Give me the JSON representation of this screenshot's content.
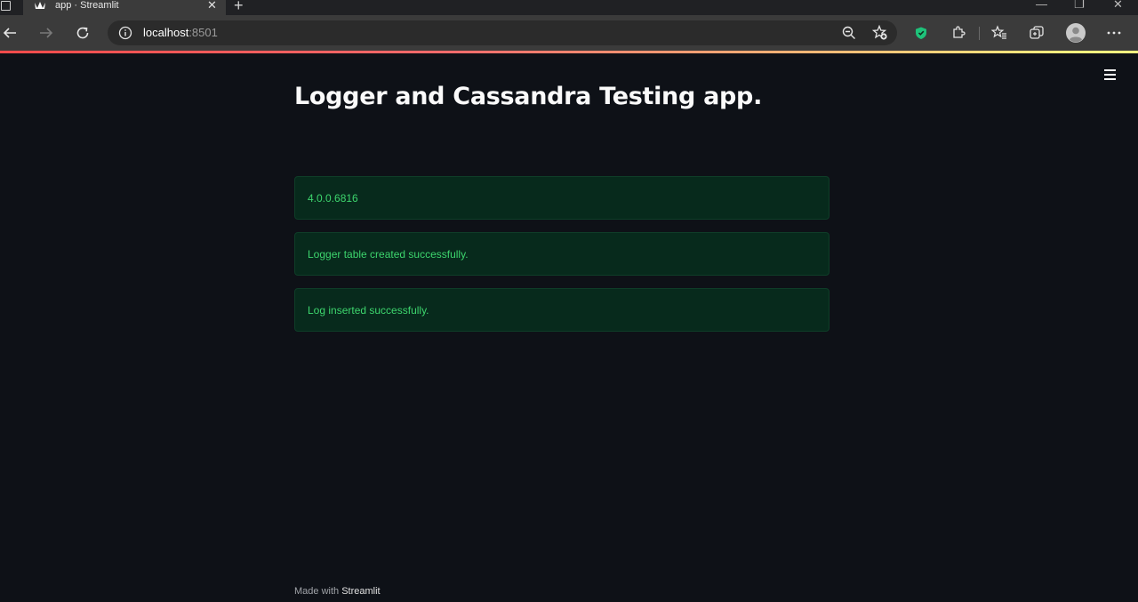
{
  "browser": {
    "tab_title": "app · Streamlit",
    "address": {
      "host": "localhost",
      "port": ":8501"
    },
    "icons": {
      "back": "arrow-left-icon",
      "forward": "arrow-right-icon",
      "reload": "reload-icon",
      "info": "info-icon",
      "zoom": "zoom-out-icon",
      "favorite_add": "star-plus-icon",
      "shield": "shield-icon",
      "extensions": "puzzle-icon",
      "favorites": "favorites-icon",
      "collections": "collections-icon",
      "profile": "avatar",
      "more": "more-icon"
    },
    "accent_loadbar": "#ff4b4b"
  },
  "app": {
    "title": "Logger and Cassandra Testing app.",
    "alerts": [
      {
        "text": "4.0.0.6816"
      },
      {
        "text": "Logger table created successfully."
      },
      {
        "text": "Log inserted successfully."
      }
    ],
    "footer": {
      "prefix": "Made with ",
      "brand": "Streamlit"
    },
    "colors": {
      "background": "#0e1117",
      "success_bg": "#072a1c",
      "success_text": "#3dd56d"
    }
  }
}
